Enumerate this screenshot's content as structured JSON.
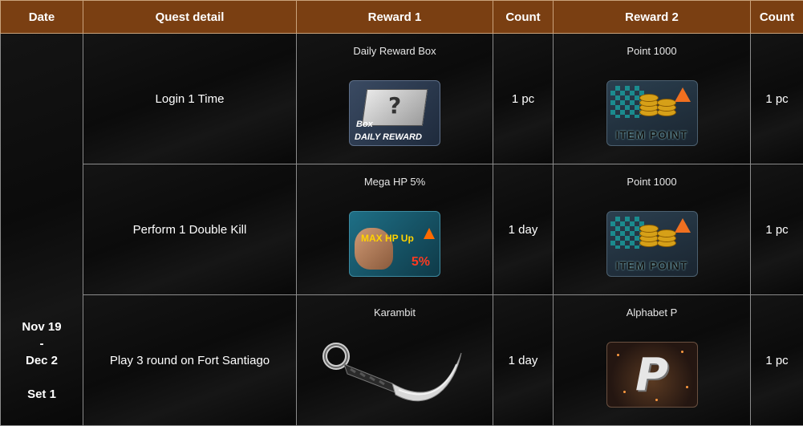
{
  "header": {
    "date": "Date",
    "quest_detail": "Quest detail",
    "reward1": "Reward 1",
    "count1": "Count",
    "reward2": "Reward 2",
    "count2": "Count"
  },
  "date_cell": {
    "line1": "Nov 19",
    "line2": "-",
    "line3": "Dec 2",
    "line4": "Set 1"
  },
  "rows": [
    {
      "quest": "Login 1 Time",
      "reward1_name": "Daily Reward Box",
      "reward1_icon": "daily-reward-box-icon",
      "reward1_icon_text": [
        "Box",
        "DAILY REWARD"
      ],
      "count1": "1 pc",
      "reward2_name": "Point 1000",
      "reward2_icon": "item-point-icon",
      "reward2_icon_text": "ITEM POINT",
      "count2": "1 pc"
    },
    {
      "quest": "Perform 1 Double Kill",
      "reward1_name": "Mega HP 5%",
      "reward1_icon": "max-hp-up-icon",
      "reward1_icon_text": [
        "MAX HP Up",
        "5%"
      ],
      "count1": "1 day",
      "reward2_name": "Point 1000",
      "reward2_icon": "item-point-icon",
      "reward2_icon_text": "ITEM POINT",
      "count2": "1 pc"
    },
    {
      "quest": "Play 3 round on Fort Santiago",
      "reward1_name": "Karambit",
      "reward1_icon": "karambit-knife-icon",
      "count1": "1 day",
      "reward2_name": "Alphabet P",
      "reward2_icon": "alphabet-p-icon",
      "reward2_icon_text": "P",
      "count2": "1 pc"
    }
  ],
  "colors": {
    "header_bg": "#7a3f12",
    "cell_bg": "#0e0e0e",
    "text": "#ffffff"
  }
}
